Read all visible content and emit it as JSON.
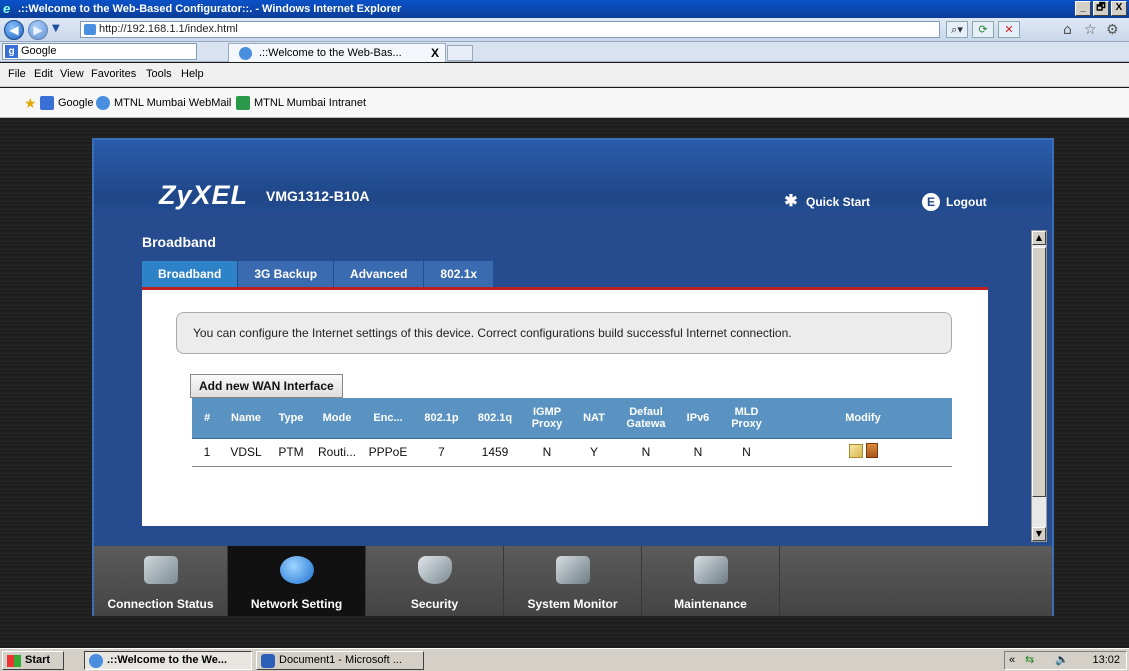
{
  "window": {
    "title": ".::Welcome to the Web-Based Configurator::. - Windows Internet Explorer",
    "min": "_",
    "max": "🗗",
    "close": "X"
  },
  "browser": {
    "url": "http://192.168.1.1/index.html",
    "search_box": "Google",
    "tab_title": ".::Welcome to the Web-Bas...",
    "tab_close": "X",
    "menu": [
      "File",
      "Edit",
      "View",
      "Favorites",
      "Tools",
      "Help"
    ],
    "favorites": [
      "Google",
      "MTNL Mumbai WebMail",
      "MTNL Mumbai Intranet"
    ]
  },
  "router": {
    "brand": "ZyXEL",
    "model": "VMG1312-B10A",
    "quick_start": "Quick Start",
    "logout": "Logout",
    "section_title": "Broadband",
    "tabs": [
      "Broadband",
      "3G Backup",
      "Advanced",
      "802.1x"
    ],
    "info_text": "You can configure the Internet settings of this device. Correct configurations build successful Internet connection.",
    "add_button": "Add new WAN Interface",
    "table": {
      "headers": [
        "#",
        "Name",
        "Type",
        "Mode",
        "Enc...",
        "802.1p",
        "802.1q",
        "IGMP Proxy",
        "NAT",
        "Defaul Gatewa",
        "IPv6",
        "MLD Proxy",
        "Modify"
      ],
      "rows": [
        [
          "1",
          "VDSL",
          "PTM",
          "Routi...",
          "PPPoE",
          "7",
          "1459",
          "N",
          "Y",
          "N",
          "N",
          "N"
        ]
      ]
    },
    "bottom_nav": [
      "Connection Status",
      "Network Setting",
      "Security",
      "System Monitor",
      "Maintenance"
    ]
  },
  "taskbar": {
    "start": "Start",
    "tasks": [
      ".::Welcome to the We...",
      "Document1 - Microsoft ..."
    ],
    "clock": "13:02"
  },
  "colors": {
    "panel": "#264b8e",
    "active_tab": "#2e82c8",
    "table_header": "#5a93c2",
    "accent_red": "#c02020"
  }
}
